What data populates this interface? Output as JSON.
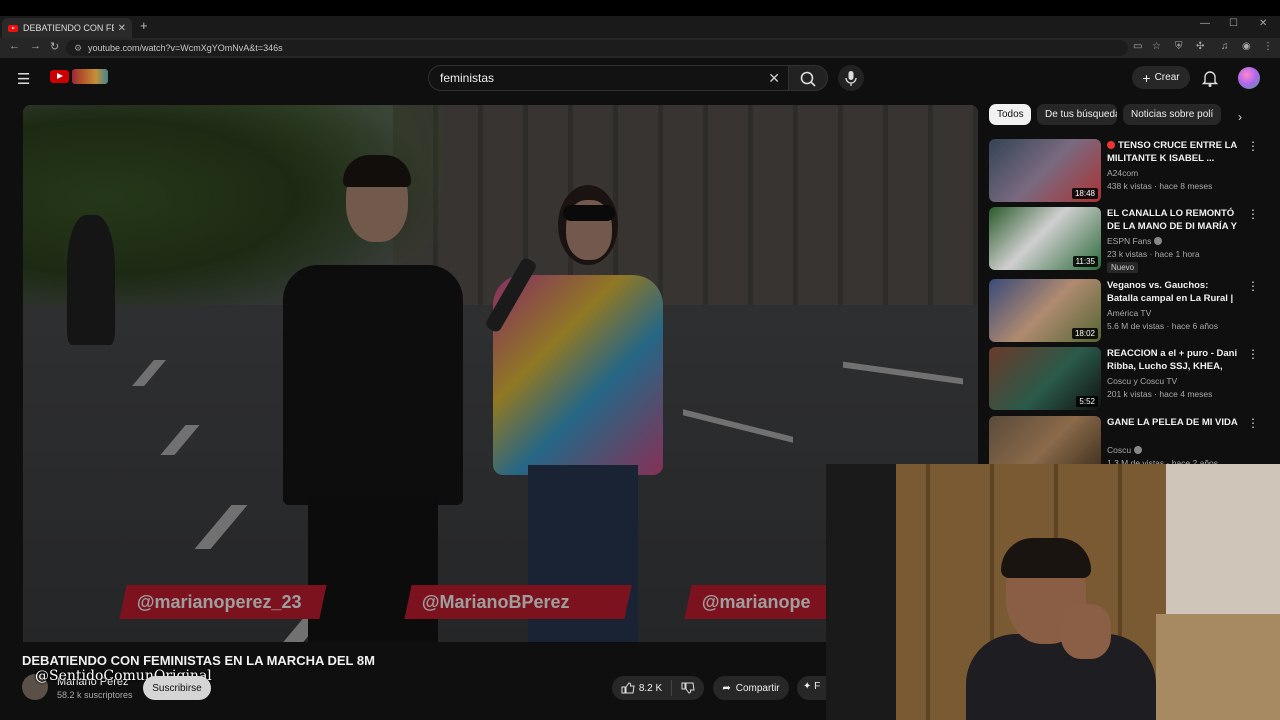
{
  "browser": {
    "tab_title": "DEBATIENDO CON FEMINISTAS",
    "url": "youtube.com/watch?v=WcmXgYOmNvA&t=346s",
    "new_tab": "+",
    "close_tab": "✕",
    "window_controls": [
      "—",
      "☐",
      "✕"
    ]
  },
  "youtube": {
    "search_query": "feministas",
    "create_label": "Crear"
  },
  "video": {
    "title": "DEBATIENDO CON FEMINISTAS EN LA MARCHA DEL 8M",
    "channel_name": "Mariano Pérez",
    "subscribers": "58.2 k suscriptores",
    "subscribe_label": "Suscribirse",
    "likes": "8.2 K",
    "share_label": "Compartir",
    "more_label": "F",
    "overlay_socials": [
      "@marianoperez_23",
      "@MarianoBPerez",
      "@marianope"
    ],
    "watermark": "@SentidoComunOriginal"
  },
  "chips": [
    "Todos",
    "De tus búsquedas",
    "Noticias sobre polí"
  ],
  "recommendations": [
    {
      "title": "TENSO CRUCE ENTRE LA MILITANTE K ISABEL ...",
      "channel": "A24com",
      "meta": "438 k vistas · hace 8 meses",
      "duration": "18:48",
      "live_dot": true,
      "badge": ""
    },
    {
      "title": "EL CANALLA LO REMONTÓ DE LA MANO DE DI MARÍA Y ES ...",
      "channel": "ESPN Fans",
      "meta": "23 k vistas · hace 1 hora",
      "duration": "11:35",
      "live_dot": false,
      "badge": "Nuevo"
    },
    {
      "title": "Veganos vs. Gauchos: Batalla campal en La Rural | Debate ...",
      "channel": "América TV",
      "meta": "5.6 M de vistas · hace 6 años",
      "duration": "18:02",
      "live_dot": false,
      "badge": ""
    },
    {
      "title": "REACCION a el + puro - Dani Ribba, Lucho SSJ, KHEA, LIT ...",
      "channel": "Coscu y Coscu TV",
      "meta": "201 k vistas · hace 4 meses",
      "duration": "5:52",
      "live_dot": false,
      "badge": ""
    },
    {
      "title": "GANE LA PELEA DE MI VIDA",
      "channel": "Coscu",
      "meta": "1.3 M de vistas · hace 2 años",
      "duration": "",
      "live_dot": false,
      "badge": ""
    }
  ],
  "colors": {
    "youtube_red": "#cc0000",
    "overlay_red": "#c81d31",
    "page_bg": "#0f0f0f"
  }
}
